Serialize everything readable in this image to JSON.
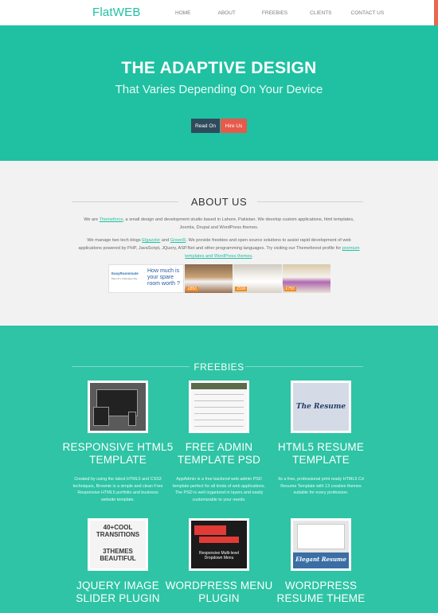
{
  "header": {
    "logo": "FlatWEB",
    "nav": [
      "HOME",
      "ABOUT",
      "FREEBIES",
      "CLIENTS",
      "CONTACT US"
    ],
    "accent_color": "#e9664f"
  },
  "hero": {
    "title": "THE ADAPTIVE DESIGN",
    "subtitle": "That Varies Depending On Your Device",
    "read_button": "Read On",
    "hire_button": "Hire Us",
    "bg_color": "#1fc1a2"
  },
  "about": {
    "title": "ABOUT US",
    "p1_pre": "We are ",
    "p1_link": "Themeforce",
    "p1_post": ", a small design and development studio based in Lahore, Pakistan. We develop custom applications, html templates, Joomla, Drupal and WordPress themes.",
    "p2_pre": "We manage two tech blogs ",
    "p2_link1": "Elgazzler",
    "p2_mid1": " and ",
    "p2_link2": "GreenR",
    "p2_mid2": ". We provide freebies and open source solutions to assist rapid development of web applications powered by PHP, JavaScript, JQuery, ASP.Net and other programming languages. Try visiting our Themeforest profile for ",
    "p2_link3": "premium templates and WordPress themes",
    "p2_post": ".",
    "ad": {
      "brand": "EasyRoommate",
      "brand_accent": "Easy",
      "tagline": "Meet 47+ Flatmates Sky",
      "question": "How much is your spare room worth ?",
      "prices": [
        "£850",
        "£590",
        "£750"
      ]
    }
  },
  "freebies": {
    "title": "FREEBIES",
    "items": [
      {
        "title": "RESPONSIVE HTML5 TEMPLATE",
        "desc": "Created by using the latest HTML5 and CSS3 techniques, Brownie is a simple and clean Free Responsive HTML5 portfolio and business website template."
      },
      {
        "title": "FREE ADMIN TEMPLATE PSD",
        "desc": "AppAdmin is a free backend web admin PSD template perfect for all kinds of web applications. The PSD is well organized in layers and easily customizable to your needs."
      },
      {
        "title": "HTML5 RESUME TEMPLATE",
        "desc": "Its a free, professional print ready HTML5 Cd Resume Template with 13 creative themes suitable for every profession."
      },
      {
        "title": "JQUERY IMAGE SLIDER PLUGIN",
        "desc": ""
      },
      {
        "title": "WORDPRESS MENU PLUGIN",
        "desc": ""
      },
      {
        "title": "WORDPRESS RESUME THEME",
        "desc": ""
      }
    ],
    "thumb_texts": {
      "resume": "The Resume",
      "cool_a": "40+COOL TRANSITIONS",
      "cool_b": "3THEMES BEAUTIFUL",
      "menu": "Responsive Multi-level Dropdown Menu",
      "elegant": "Elegant Resume"
    }
  }
}
